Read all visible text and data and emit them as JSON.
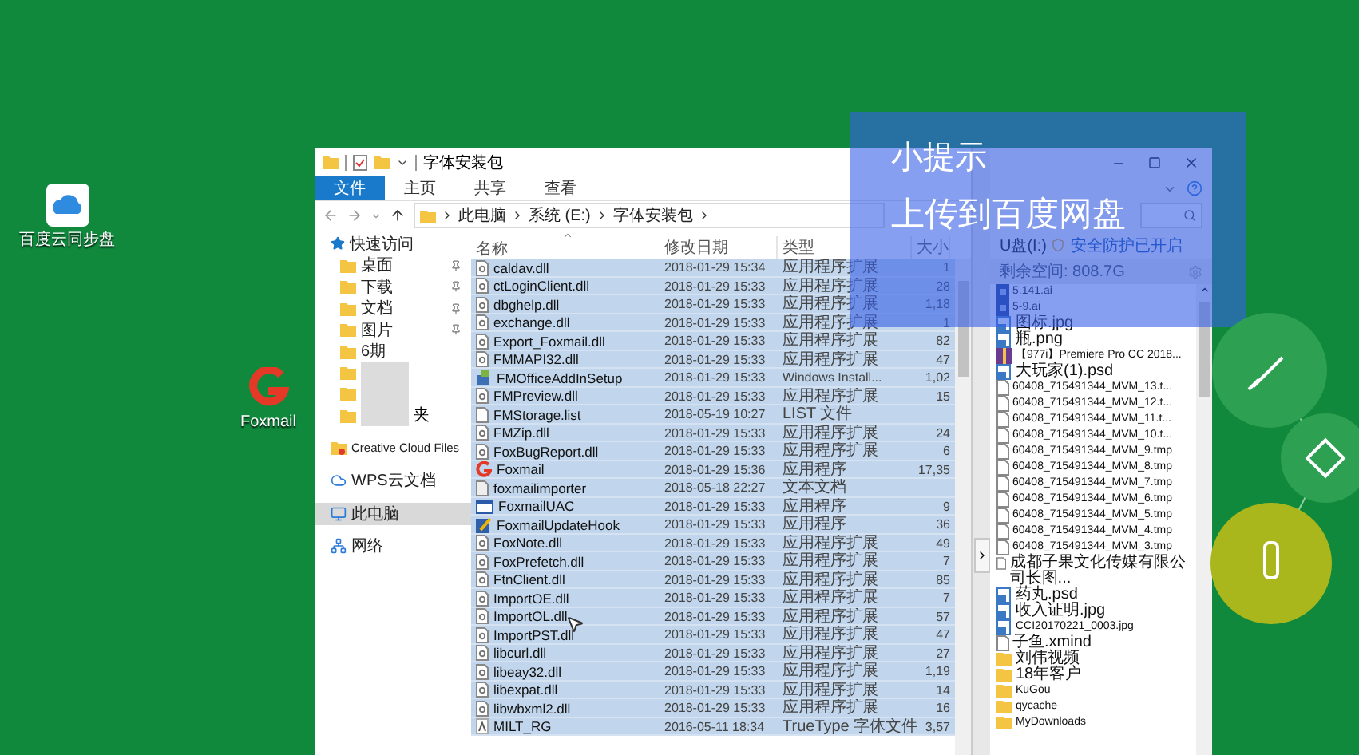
{
  "desktop_icons": [
    {
      "label": "百度云同步盘",
      "kind": "cloud-sync"
    },
    {
      "label": "Foxmail",
      "kind": "mail"
    }
  ],
  "explorer": {
    "title": "字体安装包",
    "ribbon_tabs": [
      {
        "label": "文件",
        "selected": true
      },
      {
        "label": "主页",
        "selected": false
      },
      {
        "label": "共享",
        "selected": false
      },
      {
        "label": "查看",
        "selected": false
      }
    ],
    "path": [
      "此电脑",
      "系统 (E:)",
      "字体安装包"
    ],
    "nav": [
      {
        "label": "快速访问",
        "kind": "quick",
        "pinned": false,
        "selected": false
      },
      {
        "label": "桌面",
        "kind": "folder",
        "pinned": true,
        "selected": false
      },
      {
        "label": "下载",
        "kind": "folder",
        "pinned": true,
        "selected": false
      },
      {
        "label": "文档",
        "kind": "folder",
        "pinned": true,
        "selected": false
      },
      {
        "label": "图片",
        "kind": "folder",
        "pinned": true,
        "selected": false
      },
      {
        "label": "6期",
        "kind": "folder",
        "pinned": false,
        "selected": false
      },
      {
        "label": "夹",
        "kind": "redacted",
        "pinned": false,
        "selected": false
      },
      {
        "label": "Creative Cloud Files",
        "kind": "cloud-files",
        "pinned": false,
        "selected": false
      },
      {
        "label": "WPS云文档",
        "kind": "wps",
        "pinned": false,
        "selected": false
      },
      {
        "label": "此电脑",
        "kind": "pc",
        "pinned": false,
        "selected": true
      },
      {
        "label": "网络",
        "kind": "network",
        "pinned": false,
        "selected": false
      }
    ],
    "columns": [
      "名称",
      "修改日期",
      "类型",
      "大小"
    ],
    "rows": [
      {
        "name": "caldav.dll",
        "date": "2018-01-29 15:34",
        "type": "应用程序扩展",
        "size": "1",
        "kind": "dll",
        "selected": true
      },
      {
        "name": "ctLoginClient.dll",
        "date": "2018-01-29 15:33",
        "type": "应用程序扩展",
        "size": "28",
        "kind": "dll",
        "selected": true
      },
      {
        "name": "dbghelp.dll",
        "date": "2018-01-29 15:33",
        "type": "应用程序扩展",
        "size": "1,18",
        "kind": "dll",
        "selected": true
      },
      {
        "name": "exchange.dll",
        "date": "2018-01-29 15:33",
        "type": "应用程序扩展",
        "size": "1",
        "kind": "dll",
        "selected": true
      },
      {
        "name": "Export_Foxmail.dll",
        "date": "2018-01-29 15:33",
        "type": "应用程序扩展",
        "size": "82",
        "kind": "dll",
        "selected": true
      },
      {
        "name": "FMMAPI32.dll",
        "date": "2018-01-29 15:33",
        "type": "应用程序扩展",
        "size": "47",
        "kind": "dll",
        "selected": true
      },
      {
        "name": "FMOfficeAddInSetup",
        "date": "2018-01-29 15:33",
        "type": "Windows Install...",
        "size": "1,02",
        "kind": "installer",
        "selected": true
      },
      {
        "name": "FMPreview.dll",
        "date": "2018-01-29 15:33",
        "type": "应用程序扩展",
        "size": "15",
        "kind": "dll",
        "selected": true
      },
      {
        "name": "FMStorage.list",
        "date": "2018-05-19 10:27",
        "type": "LIST 文件",
        "kind": "document",
        "selected": true
      },
      {
        "name": "FMZip.dll",
        "date": "2018-01-29 15:33",
        "type": "应用程序扩展",
        "size": "24",
        "kind": "dll",
        "selected": true
      },
      {
        "name": "FoxBugReport.dll",
        "date": "2018-01-29 15:33",
        "type": "应用程序扩展",
        "size": "6",
        "kind": "dll",
        "selected": true
      },
      {
        "name": "Foxmail",
        "date": "2018-01-29 15:36",
        "type": "应用程序",
        "size": "17,35",
        "kind": "swirl",
        "selected": true
      },
      {
        "name": "foxmailimporter",
        "date": "2018-05-18 22:27",
        "type": "文本文档",
        "kind": "text",
        "selected": true
      },
      {
        "name": "FoxmailUAC",
        "date": "2018-01-29 15:33",
        "type": "应用程序",
        "size": "9",
        "kind": "window",
        "selected": true
      },
      {
        "name": "FoxmailUpdateHook",
        "date": "2018-01-29 15:33",
        "type": "应用程序",
        "size": "36",
        "kind": "pen",
        "selected": true
      },
      {
        "name": "FoxNote.dll",
        "date": "2018-01-29 15:33",
        "type": "应用程序扩展",
        "size": "49",
        "kind": "dll",
        "selected": true
      },
      {
        "name": "FoxPrefetch.dll",
        "date": "2018-01-29 15:33",
        "type": "应用程序扩展",
        "size": "7",
        "kind": "dll",
        "selected": true
      },
      {
        "name": "FtnClient.dll",
        "date": "2018-01-29 15:33",
        "type": "应用程序扩展",
        "size": "85",
        "kind": "dll",
        "selected": true
      },
      {
        "name": "ImportOE.dll",
        "date": "2018-01-29 15:33",
        "type": "应用程序扩展",
        "size": "7",
        "kind": "dll",
        "selected": true
      },
      {
        "name": "ImportOL.dll",
        "date": "2018-01-29 15:33",
        "type": "应用程序扩展",
        "size": "57",
        "kind": "dll",
        "selected": true
      },
      {
        "name": "ImportPST.dll",
        "date": "2018-01-29 15:33",
        "type": "应用程序扩展",
        "size": "47",
        "kind": "dll",
        "selected": true
      },
      {
        "name": "libcurl.dll",
        "date": "2018-01-29 15:33",
        "type": "应用程序扩展",
        "size": "27",
        "kind": "dll",
        "selected": true
      },
      {
        "name": "libeay32.dll",
        "date": "2018-01-29 15:33",
        "type": "应用程序扩展",
        "size": "1,19",
        "kind": "dll",
        "selected": true
      },
      {
        "name": "libexpat.dll",
        "date": "2018-01-29 15:33",
        "type": "应用程序扩展",
        "size": "14",
        "kind": "dll",
        "selected": true
      },
      {
        "name": "libwbxml2.dll",
        "date": "2018-01-29 15:33",
        "type": "应用程序扩展",
        "size": "16",
        "kind": "dll",
        "selected": true
      },
      {
        "name": "MILT_RG",
        "date": "2016-05-11 18:34",
        "type": "TrueType 字体文件",
        "size": "3,57",
        "kind": "font",
        "selected": true
      }
    ]
  },
  "upload_window": {
    "drive": "U盘(I:)",
    "protection": "安全防护已开启",
    "free_space": "剩余空间: 808.7G",
    "files": [
      {
        "name": "5.141.ai",
        "kind": "ai"
      },
      {
        "name": "5-9.ai",
        "kind": "ai"
      },
      {
        "name": "图标.jpg",
        "kind": "image"
      },
      {
        "name": "瓶.png",
        "kind": "image"
      },
      {
        "name": "【977i】Premiere Pro CC 2018...",
        "kind": "archive"
      },
      {
        "name": "大玩家(1).psd",
        "kind": "image"
      },
      {
        "name": "60408_715491344_MVM_13.t...",
        "kind": "document"
      },
      {
        "name": "60408_715491344_MVM_12.t...",
        "kind": "document"
      },
      {
        "name": "60408_715491344_MVM_11.t...",
        "kind": "document"
      },
      {
        "name": "60408_715491344_MVM_10.t...",
        "kind": "document"
      },
      {
        "name": "60408_715491344_MVM_9.tmp",
        "kind": "document"
      },
      {
        "name": "60408_715491344_MVM_8.tmp",
        "kind": "document"
      },
      {
        "name": "60408_715491344_MVM_7.tmp",
        "kind": "document"
      },
      {
        "name": "60408_715491344_MVM_6.tmp",
        "kind": "document"
      },
      {
        "name": "60408_715491344_MVM_5.tmp",
        "kind": "document"
      },
      {
        "name": "60408_715491344_MVM_4.tmp",
        "kind": "document"
      },
      {
        "name": "60408_715491344_MVM_3.tmp",
        "kind": "document"
      },
      {
        "name": "成都子果文化传媒有限公司长图...",
        "kind": "document"
      },
      {
        "name": "药丸.psd",
        "kind": "image"
      },
      {
        "name": "收入证明.jpg",
        "kind": "image"
      },
      {
        "name": "CCI20170221_0003.jpg",
        "kind": "image"
      },
      {
        "name": "子鱼.xmind",
        "kind": "document"
      },
      {
        "name": "刘伟视频",
        "kind": "folder"
      },
      {
        "name": "18年客户",
        "kind": "folder"
      },
      {
        "name": "KuGou",
        "kind": "folder"
      },
      {
        "name": "qycache",
        "kind": "folder"
      },
      {
        "name": "MyDownloads",
        "kind": "folder"
      }
    ]
  },
  "tip": {
    "title": "小提示",
    "text": "上传到百度网盘"
  }
}
